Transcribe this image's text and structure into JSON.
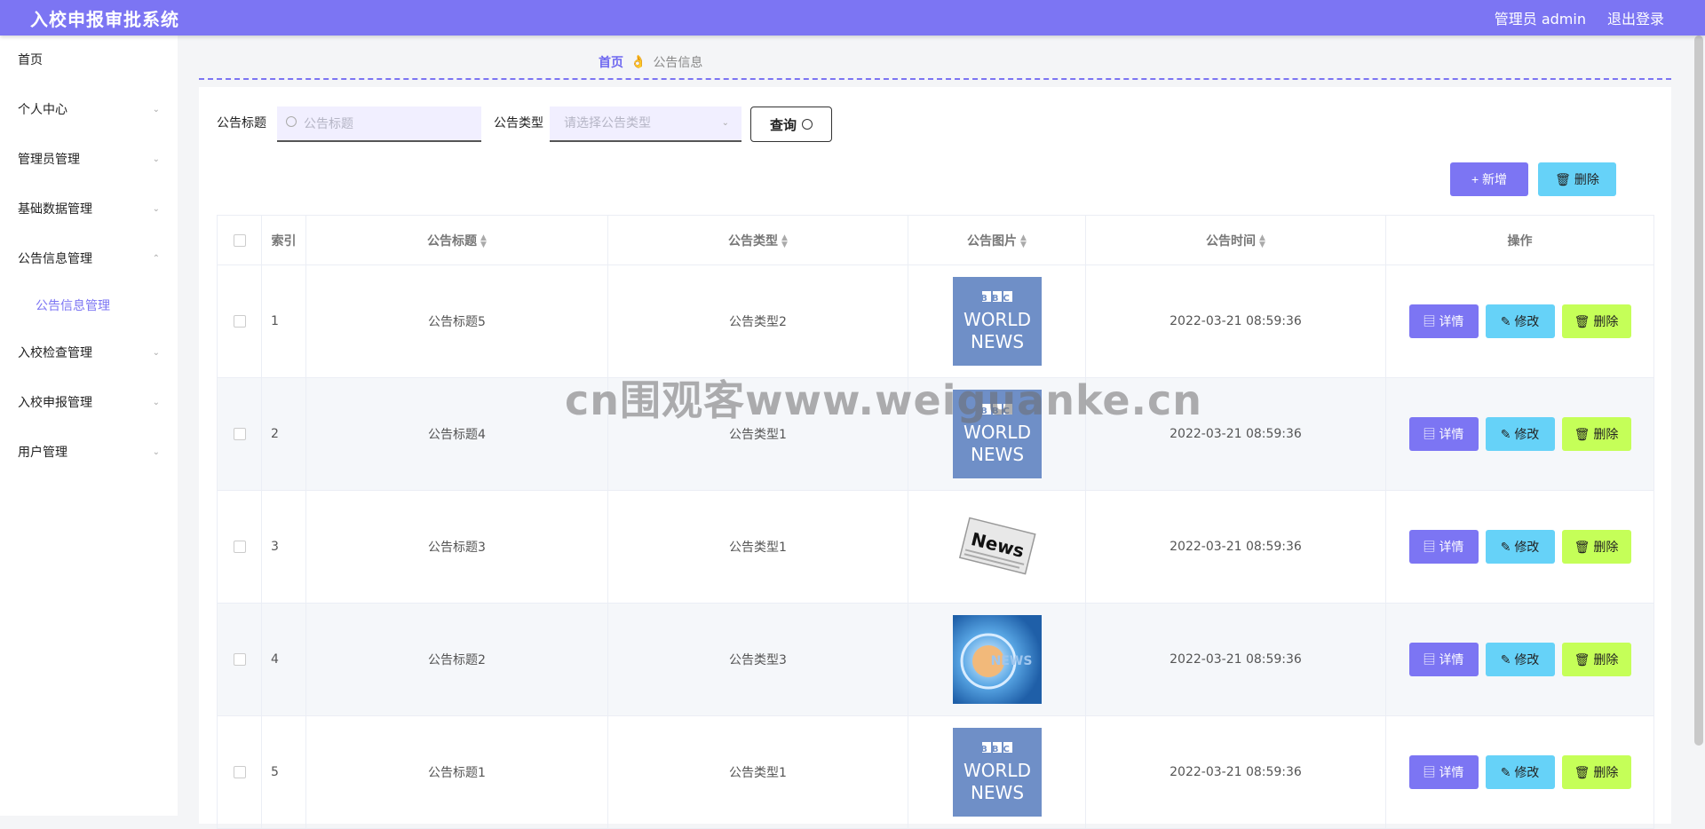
{
  "header": {
    "title": "入校申报审批系统",
    "admin_label": "管理员 admin",
    "logout_label": "退出登录"
  },
  "sidebar": {
    "items": [
      {
        "label": "首页"
      },
      {
        "label": "个人中心"
      },
      {
        "label": "管理员管理"
      },
      {
        "label": "基础数据管理"
      },
      {
        "label": "公告信息管理"
      },
      {
        "label": "公告信息管理"
      },
      {
        "label": "入校检查管理"
      },
      {
        "label": "入校申报管理"
      },
      {
        "label": "用户管理"
      }
    ]
  },
  "breadcrumb": {
    "home": "首页",
    "separator": "👌",
    "current": "公告信息"
  },
  "search": {
    "title_label": "公告标题",
    "title_placeholder": "公告标题",
    "type_label": "公告类型",
    "type_placeholder": "请选择公告类型",
    "query_label": "查询"
  },
  "actions": {
    "add_label": "+ 新增",
    "delete_label": "🗑 删除"
  },
  "table": {
    "columns": [
      "索引",
      "公告标题",
      "公告类型",
      "公告图片",
      "公告时间",
      "操作"
    ],
    "rows": [
      {
        "index": "1",
        "title": "公告标题5",
        "type": "公告类型2",
        "image": "bbc-world-news",
        "time": "2022-03-21 08:59:36"
      },
      {
        "index": "2",
        "title": "公告标题4",
        "type": "公告类型1",
        "image": "bbc-world-news",
        "time": "2022-03-21 08:59:36"
      },
      {
        "index": "3",
        "title": "公告标题3",
        "type": "公告类型1",
        "image": "newspaper-news",
        "time": "2022-03-21 08:59:36"
      },
      {
        "index": "4",
        "title": "公告标题2",
        "type": "公告类型3",
        "image": "blue-news-globe",
        "time": "2022-03-21 08:59:36"
      },
      {
        "index": "5",
        "title": "公告标题1",
        "type": "公告类型1",
        "image": "bbc-world-news",
        "time": "2022-03-21 08:59:36"
      }
    ],
    "row_actions": {
      "detail": "详情",
      "edit": "修改",
      "delete": "删除"
    }
  },
  "images": {
    "bbc": {
      "line1": "BBC",
      "line2": "WORLD",
      "line3": "NEWS"
    },
    "newspaper": "News",
    "globe": "NEWS"
  },
  "watermark": "cn围观客www.weiguanke.cn",
  "colors": {
    "primary": "#7c75f3",
    "info": "#66d2f8",
    "lime": "#c5ff58"
  }
}
